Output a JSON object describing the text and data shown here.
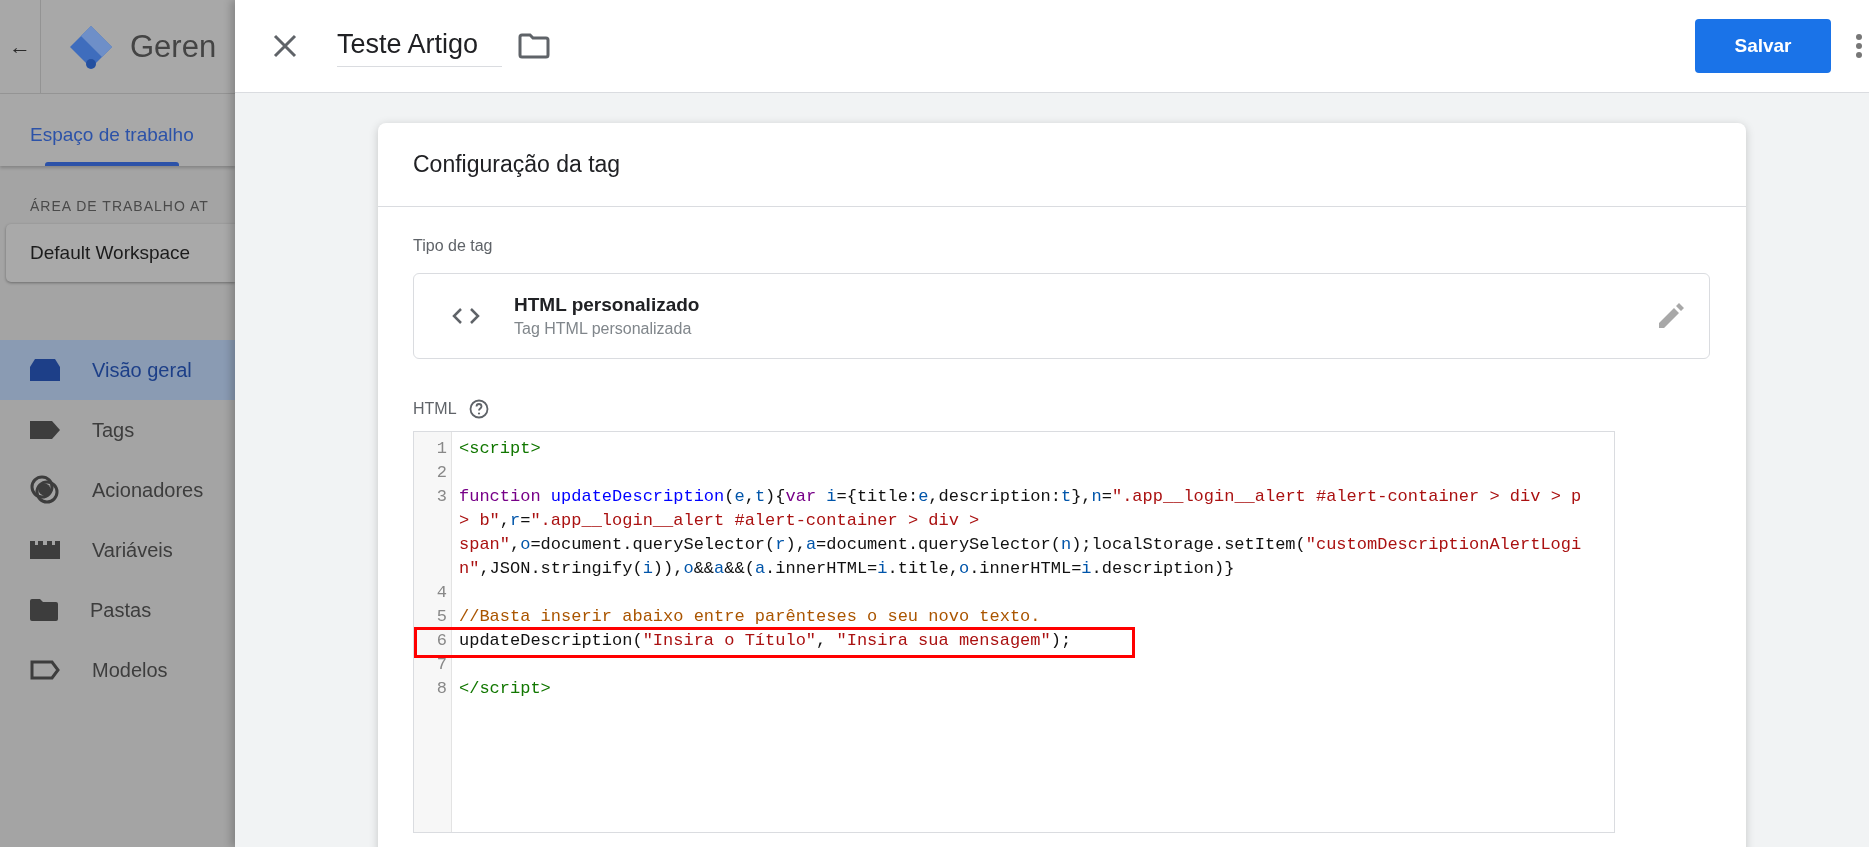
{
  "background": {
    "back_label": "←",
    "product_name": "Geren",
    "tabs": [
      {
        "label": "Espaço de trabalho",
        "selected": true
      }
    ],
    "workspace_heading": "ÁREA DE TRABALHO AT",
    "workspace_name": "Default Workspace",
    "nav": [
      {
        "label": "Visão geral",
        "selected": true
      },
      {
        "label": "Tags",
        "selected": false
      },
      {
        "label": "Acionadores",
        "selected": false
      },
      {
        "label": "Variáveis",
        "selected": false
      },
      {
        "label": "Pastas",
        "selected": false
      },
      {
        "label": "Modelos",
        "selected": false
      }
    ]
  },
  "drawer": {
    "title": "Teste Artigo",
    "save_label": "Salvar",
    "card": {
      "title": "Configuração da tag",
      "type_label": "Tipo de tag",
      "type_name": "HTML personalizado",
      "type_desc": "Tag HTML personalizada",
      "html_label": "HTML",
      "lines": [
        {
          "number": "1",
          "highlighted": false,
          "tokens": [
            {
              "kind": "tag",
              "text": "<script>"
            }
          ]
        },
        {
          "number": "2",
          "highlighted": false
        },
        {
          "number": "3",
          "highlighted": false,
          "tokens": [
            {
              "kind": "keyword",
              "text": "function "
            },
            {
              "kind": "def",
              "text": "updateDescription"
            },
            {
              "kind": "plain",
              "text": "("
            },
            {
              "kind": "var",
              "text": "e"
            },
            {
              "kind": "plain",
              "text": ","
            },
            {
              "kind": "var",
              "text": "t"
            },
            {
              "kind": "plain",
              "text": "){"
            },
            {
              "kind": "keyword",
              "text": "var "
            },
            {
              "kind": "var",
              "text": "i"
            },
            {
              "kind": "plain",
              "text": "={title:"
            },
            {
              "kind": "var",
              "text": "e"
            },
            {
              "kind": "plain",
              "text": ",description:"
            },
            {
              "kind": "var",
              "text": "t"
            },
            {
              "kind": "plain",
              "text": "},"
            },
            {
              "kind": "var",
              "text": "n"
            },
            {
              "kind": "plain",
              "text": "="
            },
            {
              "kind": "string",
              "text": "\".app__login__alert #alert-container > div > p > b\""
            },
            {
              "kind": "plain",
              "text": ","
            },
            {
              "kind": "var",
              "text": "r"
            },
            {
              "kind": "plain",
              "text": "="
            },
            {
              "kind": "string",
              "text": "\".app__login__alert #alert-container > div > span\""
            },
            {
              "kind": "plain",
              "text": ","
            },
            {
              "kind": "var",
              "text": "o"
            },
            {
              "kind": "plain",
              "text": "=document.querySelector("
            },
            {
              "kind": "var",
              "text": "r"
            },
            {
              "kind": "plain",
              "text": "),"
            },
            {
              "kind": "var",
              "text": "a"
            },
            {
              "kind": "plain",
              "text": "=document.querySelector("
            },
            {
              "kind": "var",
              "text": "n"
            },
            {
              "kind": "plain",
              "text": ");localStorage.setItem("
            },
            {
              "kind": "string",
              "text": "\"customDescriptionAlertLogin\""
            },
            {
              "kind": "plain",
              "text": ",JSON.stringify("
            },
            {
              "kind": "var",
              "text": "i"
            },
            {
              "kind": "plain",
              "text": ")),"
            },
            {
              "kind": "var",
              "text": "o"
            },
            {
              "kind": "plain",
              "text": "&&"
            },
            {
              "kind": "var",
              "text": "a"
            },
            {
              "kind": "plain",
              "text": "&&("
            },
            {
              "kind": "var",
              "text": "a"
            },
            {
              "kind": "plain",
              "text": ".innerHTML="
            },
            {
              "kind": "var",
              "text": "i"
            },
            {
              "kind": "plain",
              "text": ".title,"
            },
            {
              "kind": "var",
              "text": "o"
            },
            {
              "kind": "plain",
              "text": ".innerHTML="
            },
            {
              "kind": "var",
              "text": "i"
            },
            {
              "kind": "plain",
              "text": ".description)}"
            }
          ]
        },
        {
          "number": "4",
          "highlighted": false
        },
        {
          "number": "5",
          "highlighted": false,
          "tokens": [
            {
              "kind": "comment",
              "text": "//Basta inserir abaixo entre parênteses o seu novo texto."
            }
          ]
        },
        {
          "number": "6",
          "highlighted": true,
          "tokens": [
            {
              "kind": "plain",
              "text": "updateDescription("
            },
            {
              "kind": "string",
              "text": "\"Insira o Título\""
            },
            {
              "kind": "plain",
              "text": ", "
            },
            {
              "kind": "string",
              "text": "\"Insira sua mensagem\""
            },
            {
              "kind": "plain",
              "text": ");"
            }
          ]
        },
        {
          "number": "7",
          "highlighted": false
        },
        {
          "number": "8",
          "highlighted": false,
          "tokens": [
            {
              "kind": "tag",
              "text": "</script>"
            }
          ]
        }
      ]
    }
  }
}
